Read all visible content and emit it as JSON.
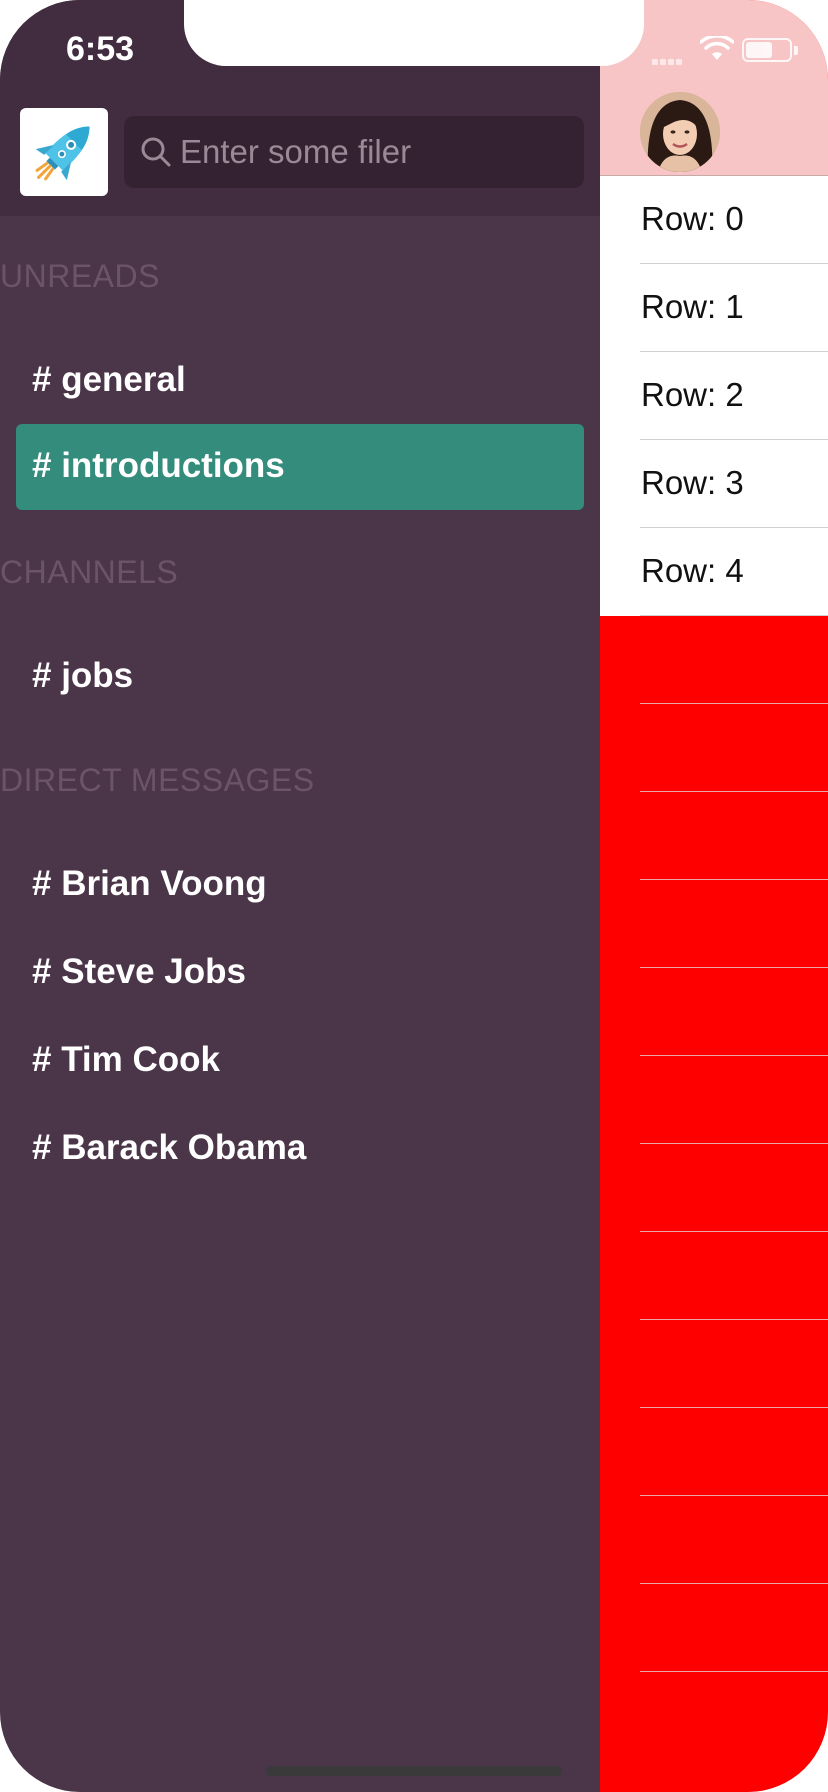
{
  "status_bar": {
    "time": "6:53"
  },
  "sidebar": {
    "search": {
      "placeholder": "Enter some filer"
    },
    "sections": {
      "unreads": {
        "title": "UNREADS",
        "items": [
          {
            "label": "# general"
          },
          {
            "label": "# introductions"
          }
        ]
      },
      "channels": {
        "title": "CHANNELS",
        "items": [
          {
            "label": "# jobs"
          }
        ]
      },
      "direct_messages": {
        "title": "DIRECT MESSAGES",
        "items": [
          {
            "label": "# Brian Voong"
          },
          {
            "label": "# Steve Jobs"
          },
          {
            "label": "# Tim Cook"
          },
          {
            "label": "# Barack Obama"
          }
        ]
      }
    },
    "selected_item": "# introductions",
    "icons": {
      "logo": "rocket-logo-icon",
      "search": "search-icon"
    }
  },
  "content": {
    "rows": [
      {
        "label": "Row: 0"
      },
      {
        "label": "Row: 1"
      },
      {
        "label": "Row: 2"
      },
      {
        "label": "Row: 3"
      },
      {
        "label": "Row: 4"
      }
    ],
    "empty_row_count": 12,
    "icons": {
      "avatar": "user-avatar"
    }
  },
  "colors": {
    "sidebar_bg": "#4b3549",
    "sidebar_header_bg": "#422d40",
    "selected_bg": "#348d7c",
    "content_header_bg": "#f7c5c5",
    "content_bg": "#ff0000"
  }
}
